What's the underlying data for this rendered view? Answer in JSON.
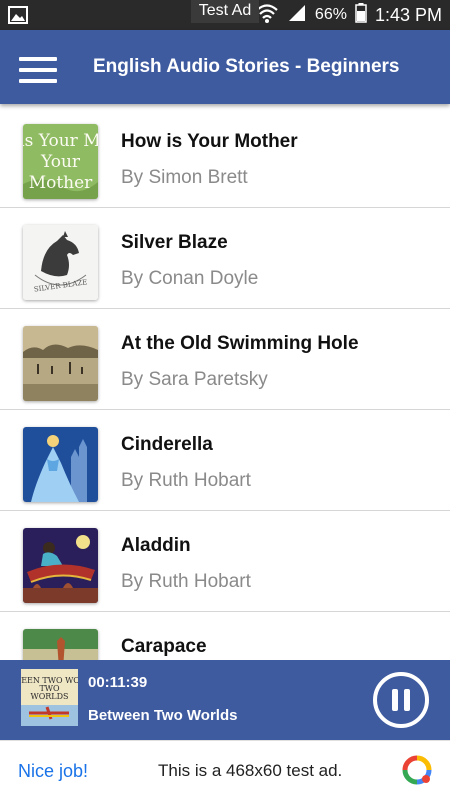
{
  "status_bar": {
    "notification_icon": "image-notification-icon",
    "battery_percent": "66%",
    "time": "1:43 PM"
  },
  "app_bar": {
    "title": "English Audio Stories - Beginners"
  },
  "stories": [
    {
      "title": "How is Your Mother",
      "author": "By Simon Brett",
      "cover_text": "How is Your Mother"
    },
    {
      "title": "Silver Blaze",
      "author": "By Conan Doyle",
      "cover_text": "SILVER BLAZE"
    },
    {
      "title": "At the Old Swimming Hole",
      "author": "By Sara Paretsky"
    },
    {
      "title": "Cinderella",
      "author": "By Ruth Hobart"
    },
    {
      "title": "Aladdin",
      "author": "By Ruth Hobart"
    },
    {
      "title": "Carapace",
      "author": ""
    }
  ],
  "player": {
    "elapsed": "00:11:39",
    "title": "Between Two Worlds",
    "cover_text": "BETWEEN TWO WORLDS"
  },
  "ad": {
    "label": "Test Ad",
    "cta": "Nice job!",
    "text": "This is a 468x60 test ad."
  },
  "colors": {
    "app_bar": "#3f5ba0",
    "status_bar": "#2a2a2a",
    "author_text": "#8a8a8a",
    "ad_link": "#1a73e8"
  }
}
